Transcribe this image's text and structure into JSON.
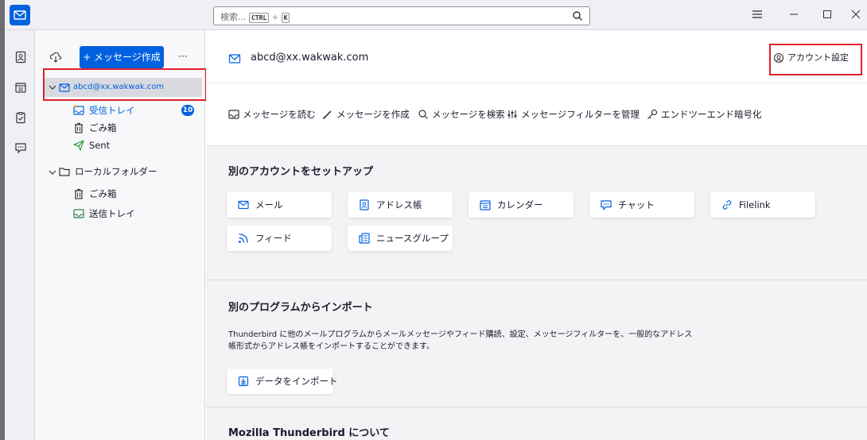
{
  "search": {
    "placeholder": "検索...",
    "shortcut_ctrl": "CTRL",
    "shortcut_plus": "+",
    "shortcut_key": "K"
  },
  "folder_pane": {
    "write_button": "+ メッセージ作成",
    "more": "···",
    "account": "abcd@xx.wakwak.com",
    "folders": [
      {
        "label": "受信トレイ",
        "unread": "10"
      },
      {
        "label": "ごみ箱"
      },
      {
        "label": "Sent"
      }
    ],
    "local_folders": "ローカルフォルダー",
    "local_items": [
      {
        "label": "ごみ箱"
      },
      {
        "label": "送信トレイ"
      }
    ]
  },
  "account_header": {
    "address": "abcd@xx.wakwak.com",
    "settings_label": "アカウント設定"
  },
  "actions": [
    {
      "label": "メッセージを読む",
      "icon": "read-icon"
    },
    {
      "label": "メッセージを作成",
      "icon": "pencil-icon"
    },
    {
      "label": "メッセージを検索",
      "icon": "search-icon"
    },
    {
      "label": "メッセージフィルターを管理",
      "icon": "filter-icon"
    },
    {
      "label": "エンドツーエンド暗号化",
      "icon": "key-icon"
    }
  ],
  "setup": {
    "title": "別のアカウントをセットアップ",
    "cards": [
      {
        "label": "メール",
        "icon": "mail-icon"
      },
      {
        "label": "アドレス帳",
        "icon": "addressbook-icon"
      },
      {
        "label": "カレンダー",
        "icon": "calendar-icon"
      },
      {
        "label": "チャット",
        "icon": "chat-icon"
      },
      {
        "label": "Filelink",
        "icon": "link-icon"
      },
      {
        "label": "フィード",
        "icon": "feed-icon"
      },
      {
        "label": "ニュースグループ",
        "icon": "newsgroup-icon"
      }
    ]
  },
  "import": {
    "title": "別のプログラムからインポート",
    "description_line1": "Thunderbird に他のメールプログラムからメールメッセージやフィード購読、設定、メッセージフィルターを、一般的なアドレス",
    "description_line2": "帳形式からアドレス帳をインポートすることができます。",
    "button": "データをインポート"
  },
  "about": {
    "title": "Mozilla Thunderbird について"
  },
  "colors": {
    "accent": "#0061e0",
    "highlight_box": "#e0202a"
  }
}
